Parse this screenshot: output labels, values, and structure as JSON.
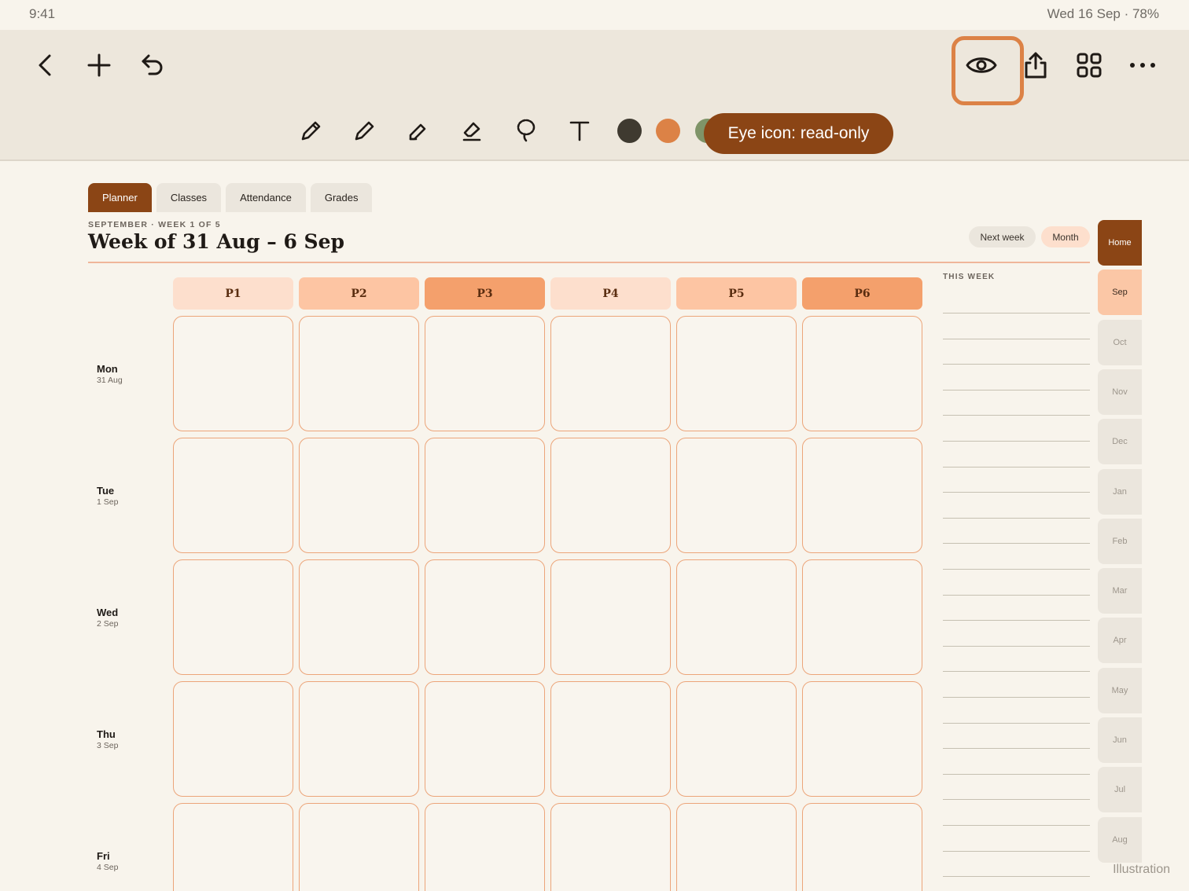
{
  "status_bar": {
    "time": "9:41",
    "right": "Wed 16 Sep · 78%"
  },
  "toolbar": {
    "back": "back-icon",
    "add": "plus-icon",
    "undo": "undo-icon",
    "view": "eye-icon",
    "share": "share-icon",
    "grid": "grid-icon",
    "more": "more-icon",
    "tools": [
      "pencil-icon",
      "pen-icon",
      "highlighter-icon",
      "eraser-icon",
      "lasso-icon",
      "text-icon"
    ],
    "colors": [
      "#3f3a30",
      "#dc8246",
      "#7f9468"
    ],
    "callout": "Eye icon: read-only"
  },
  "tabs": [
    "Planner",
    "Classes",
    "Attendance",
    "Grades"
  ],
  "header": {
    "subtitle": "SEPTEMBER · WEEK 1 OF 5",
    "title": "Week of 31 Aug – 6 Sep",
    "next_week": "Next week",
    "month": "Month"
  },
  "periods": [
    "P1",
    "P2",
    "P3",
    "P4",
    "P5",
    "P6"
  ],
  "period_colors": [
    "#fddfcd",
    "#fdc5a3",
    "#f4a06c",
    "#fddfcd",
    "#fdc5a3",
    "#f4a06c"
  ],
  "days": [
    {
      "name": "Mon",
      "date": "31 Aug"
    },
    {
      "name": "Tue",
      "date": "1 Sep"
    },
    {
      "name": "Wed",
      "date": "2 Sep"
    },
    {
      "name": "Thu",
      "date": "3 Sep"
    },
    {
      "name": "Fri",
      "date": "4 Sep"
    }
  ],
  "this_week_label": "THIS WEEK",
  "month_tabs": [
    "Home",
    "Sep",
    "Oct",
    "Nov",
    "Dec",
    "Jan",
    "Feb",
    "Mar",
    "Apr",
    "May",
    "Jun",
    "Jul",
    "Aug"
  ],
  "footer_note": "Illustration"
}
